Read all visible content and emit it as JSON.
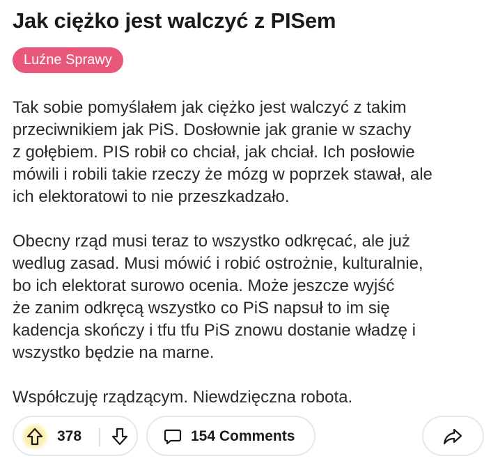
{
  "post": {
    "title": "Jak ciężko jest walczyć z PISem",
    "flair": "Luźne Sprawy",
    "body": {
      "paragraph_1": [
        "Tak sobie pomyślałem jak ciężko jest walczyć z takim",
        "przeciwnikiem jak PiS. Dosłownie jak granie w szachy",
        "z gołębiem. PIS robił co chciał, jak chciał. Ich posłowie",
        "mówili i robili takie rzeczy że mózg w poprzek stawał, ale",
        "ich elektoratowi to nie przeszkadzało."
      ],
      "paragraph_2": [
        "Obecny rząd musi teraz to wszystko odkręcać, ale już",
        "wedlug zasad. Musi mówić i robić ostrożnie, kulturalnie,",
        "bo ich elektorat surowo ocenia. Może jeszcze wyjść",
        "że zanim odkręcą wszystko co PiS napsuł to im się",
        "kadencja skończy i tfu tfu PiS znowu dostanie władzę i",
        "wszystko będzie na marne."
      ],
      "paragraph_3": [
        "Współczuję rządzącym. Niewdzięczna robota."
      ]
    }
  },
  "actions": {
    "vote_count": "378",
    "comments_label": "154 Comments",
    "upvote_icon": "arrow-up-icon",
    "downvote_icon": "arrow-down-icon",
    "comment_icon": "speech-bubble-icon",
    "share_icon": "share-arrow-icon"
  },
  "colors": {
    "flair_background": "#e8567a",
    "flair_text": "#ffffff",
    "text": "#1a1a1b",
    "pill_border": "#e5e7ea",
    "upvote_glow": "#fbeea9"
  }
}
